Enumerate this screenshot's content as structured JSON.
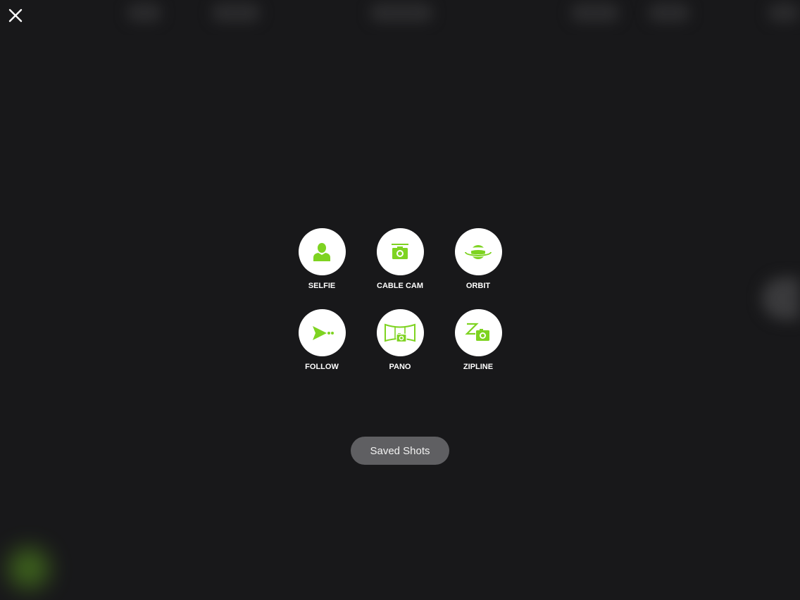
{
  "colors": {
    "background": "#18181a",
    "accent_green": "#7ed321",
    "button_bg": "#5f5f62",
    "icon_circle": "#ffffff"
  },
  "header": {
    "close_icon": "close-icon"
  },
  "shots": [
    {
      "label": "SELFIE",
      "icon": "person-icon"
    },
    {
      "label": "CABLE CAM",
      "icon": "cable-cam-icon"
    },
    {
      "label": "ORBIT",
      "icon": "orbit-icon"
    },
    {
      "label": "FOLLOW",
      "icon": "follow-icon"
    },
    {
      "label": "PANO",
      "icon": "pano-icon"
    },
    {
      "label": "ZIPLINE",
      "icon": "zipline-icon"
    }
  ],
  "saved_shots": {
    "label": "Saved Shots"
  }
}
